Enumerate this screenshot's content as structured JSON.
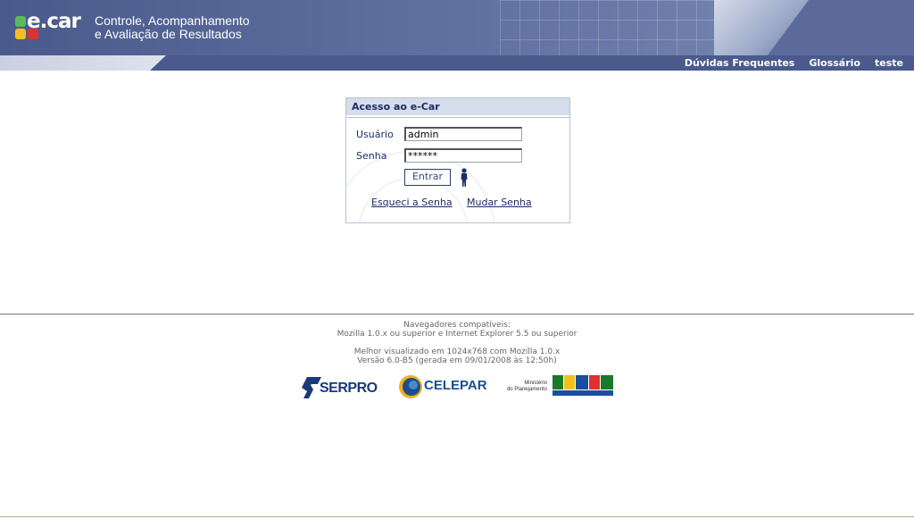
{
  "header": {
    "brand": "e.car",
    "title_line1": "Controle, Acompanhamento",
    "title_line2": "e Avaliação de Resultados"
  },
  "nav": {
    "links": [
      "Dúvidas Frequentes",
      "Glossário",
      "teste"
    ]
  },
  "login": {
    "title": "Acesso ao e-Car",
    "user_label": "Usuário",
    "user_value": "admin",
    "password_label": "Senha",
    "password_value": "******",
    "submit_label": "Entrar",
    "forgot_label": "Esqueci a Senha",
    "change_label": "Mudar Senha"
  },
  "footer": {
    "browsers_title": "Navegadores compatíveis:",
    "browsers_list": "Mozilla 1.0.x ou superior e Internet Explorer 5.5 ou superior",
    "best_view": "Melhor visualizado em 1024x768 com Mozilla 1.0.x",
    "version": "Versão 6.0-B5 (gerada em 09/01/2008 às 12:50h)",
    "logos": {
      "serpro": "SERPRO",
      "celepar": "CELEPAR",
      "ministry_line1": "Ministério",
      "ministry_line2": "do Planejamento",
      "brasil": "BRASIL",
      "brasil_tag": "UM PAÍS DE TODOS",
      "gov_federal": "GOVERNO FEDERAL"
    }
  },
  "colors": {
    "header_blue": "#4a5a8c",
    "panel_title": "#d5dcea",
    "text_navy": "#1f2c66"
  }
}
